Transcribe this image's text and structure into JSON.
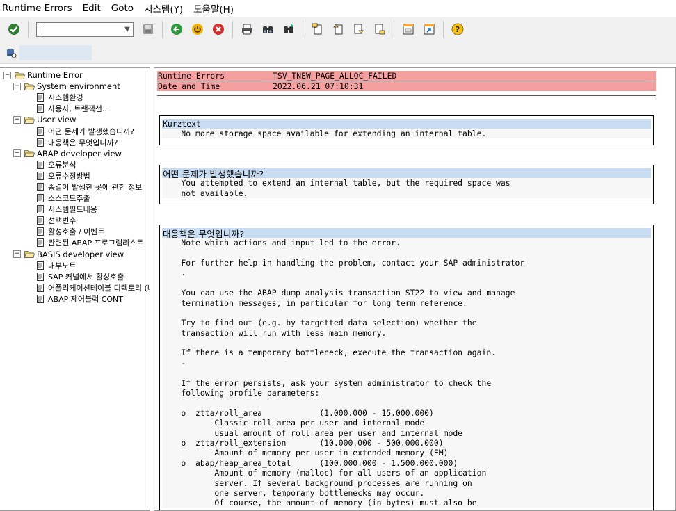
{
  "menu": [
    "Runtime Errors",
    "Edit",
    "Goto",
    "시스템(Y)",
    "도움말(H)"
  ],
  "toolbar": {
    "command_value": "",
    "buttons": [
      "enter-icon",
      "save-icon",
      "back-icon",
      "exit-icon",
      "cancel-icon",
      "print-icon",
      "find-icon",
      "find-next-icon",
      "first-page-icon",
      "prev-page-icon",
      "next-page-icon",
      "last-page-icon",
      "new-session-icon",
      "shortcut-icon",
      "help-icon"
    ]
  },
  "tree": {
    "root": "Runtime Error",
    "groups": [
      {
        "label": "System environment",
        "items": [
          "시스템환경",
          "사용자, 트랜잭션..."
        ]
      },
      {
        "label": "User view",
        "items": [
          "어떤 문제가 발생했습니까?",
          "대응책은 무엇입니까?"
        ]
      },
      {
        "label": "ABAP developer view",
        "items": [
          "오류분석",
          "오류수정방법",
          "종결이 발생한 곳에 관한 정보",
          "소스코드추출",
          "시스템필드내용",
          "선택변수",
          "활성호출 / 이벤트",
          "관련된 ABAP 프로그램리스트"
        ]
      },
      {
        "label": "BASIS developer view",
        "items": [
          "내부노트",
          "SAP 커널에서 활성호출",
          "어플리케이션테이블 디렉토리 (나",
          "ABAP 제어블럭 CONT"
        ]
      }
    ]
  },
  "header": {
    "rows": [
      {
        "key": "Runtime Errors",
        "value": "TSV_TNEW_PAGE_ALLOC_FAILED"
      },
      {
        "key": "Date and Time",
        "value": "2022.06.21 07:10:31"
      }
    ]
  },
  "sections": {
    "short_text": {
      "title": "Kurztext",
      "lines": [
        "    No more storage space available for extending an internal table."
      ]
    },
    "what_happened": {
      "title": "어떤 문제가 발생했습니까?",
      "lines": [
        "    You attempted to extend an internal table, but the required space was",
        "    not available."
      ]
    },
    "what_to_do": {
      "title": "대응책은 무엇입니까?",
      "lines": [
        "    Note which actions and input led to the error.",
        "",
        "    For further help in handling the problem, contact your SAP administrator",
        "    .",
        "",
        "    You can use the ABAP dump analysis transaction ST22 to view and manage",
        "    termination messages, in particular for long term reference.",
        "",
        "    Try to find out (e.g. by targetted data selection) whether the",
        "    transaction will run with less main memory.",
        "",
        "    If there is a temporary bottleneck, execute the transaction again.",
        "    -",
        "",
        "    If the error persists, ask your system administrator to check the",
        "    following profile parameters:",
        "",
        "    o  ztta/roll_area            (1.000.000 - 15.000.000)",
        "           Classic roll area per user and internal mode",
        "           usual amount of roll area per user and internal mode",
        "    o  ztta/roll_extension       (10.000.000 - 500.000.000)",
        "           Amount of memory per user in extended memory (EM)",
        "    o  abap/heap_area_total      (100.000.000 - 1.500.000.000)",
        "           Amount of memory (malloc) for all users of an application",
        "           server. If several background processes are running on",
        "           one server, temporary bottlenecks may occur.",
        "           Of course, the amount of memory (in bytes) must also be"
      ]
    }
  },
  "colors": {
    "header_red": "#f4a0a0",
    "section_blue": "#c8dcf2",
    "line_bg": "#f7f7f7",
    "toolbar_bg": "#f0f0f0"
  }
}
